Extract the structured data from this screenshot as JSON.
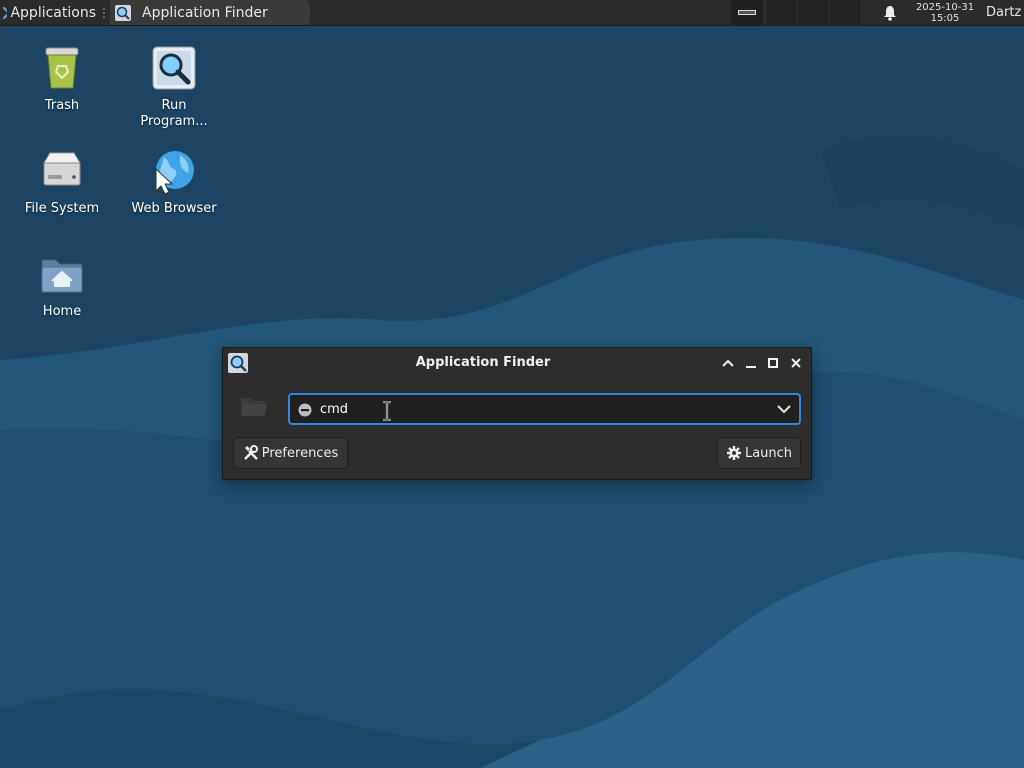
{
  "panel": {
    "applications_label": "Applications",
    "task_title": "Application Finder",
    "clock_date": "2025-10-31",
    "clock_time": "15:05",
    "user": "Dartz"
  },
  "desktop": {
    "icons": [
      {
        "label": "Trash"
      },
      {
        "label": "Run Program..."
      },
      {
        "label": "File System"
      },
      {
        "label": "Web Browser"
      },
      {
        "label": "Home"
      }
    ]
  },
  "dialog": {
    "title": "Application Finder",
    "command_value": "cmd",
    "preferences_label": "Preferences",
    "launch_label": "Launch"
  },
  "colors": {
    "accent": "#3584e4",
    "panel_bg": "#2b2b2b",
    "dialog_bg": "#2d2d2d",
    "wallpaper": "#1f4d6d"
  }
}
